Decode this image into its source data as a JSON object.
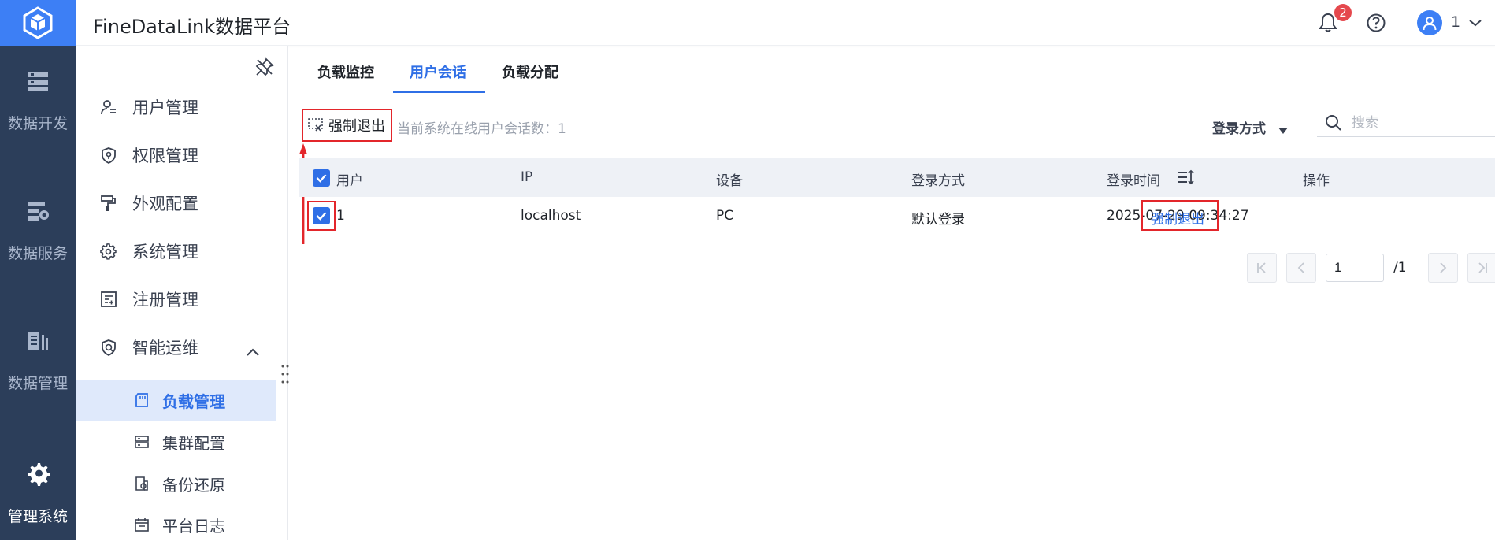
{
  "app": {
    "title": "FineDataLink数据平台"
  },
  "rail": {
    "items": [
      {
        "label": "数据开发",
        "icon": "data-dev-icon"
      },
      {
        "label": "数据服务",
        "icon": "data-service-icon"
      },
      {
        "label": "数据管理",
        "icon": "data-manage-icon"
      },
      {
        "label": "管理系统",
        "icon": "gear-icon",
        "active": true
      }
    ]
  },
  "header": {
    "notification_count": "2",
    "user_name": "1"
  },
  "sidebar": {
    "items": [
      {
        "label": "用户管理",
        "icon": "user-manage-icon"
      },
      {
        "label": "权限管理",
        "icon": "permission-shield-icon"
      },
      {
        "label": "外观配置",
        "icon": "paint-roller-icon"
      },
      {
        "label": "系统管理",
        "icon": "gear-icon"
      },
      {
        "label": "注册管理",
        "icon": "register-icon"
      },
      {
        "label": "智能运维",
        "icon": "smart-ops-icon",
        "expanded": true
      }
    ],
    "sub_items": [
      {
        "label": "负载管理",
        "icon": "load-icon",
        "active": true
      },
      {
        "label": "集群配置",
        "icon": "cluster-icon"
      },
      {
        "label": "备份还原",
        "icon": "backup-icon"
      },
      {
        "label": "平台日志",
        "icon": "calendar-log-icon"
      }
    ]
  },
  "tabs": [
    {
      "label": "负载监控"
    },
    {
      "label": "用户会话",
      "active": true
    },
    {
      "label": "负载分配"
    }
  ],
  "toolbar": {
    "force_logout_label": "强制退出",
    "online_count_text": "当前系统在线用户会话数：1",
    "login_filter_label": "登录方式",
    "search_placeholder": "搜索"
  },
  "table": {
    "columns": [
      "用户",
      "IP",
      "设备",
      "登录方式",
      "登录时间",
      "操作"
    ],
    "rows": [
      {
        "user": "1",
        "ip": "localhost",
        "device": "PC",
        "login_method": "默认登录",
        "login_time": "2025-07-29 09:34:27",
        "action": "强制退出",
        "checked": true
      }
    ],
    "header_checked": true
  },
  "pagination": {
    "current_page": "1",
    "total_text": "/1"
  },
  "colors": {
    "accent": "#2f6fe6",
    "rail_bg": "#2c3e5a",
    "highlight_box": "#e3262b",
    "badge": "#e5484d"
  }
}
